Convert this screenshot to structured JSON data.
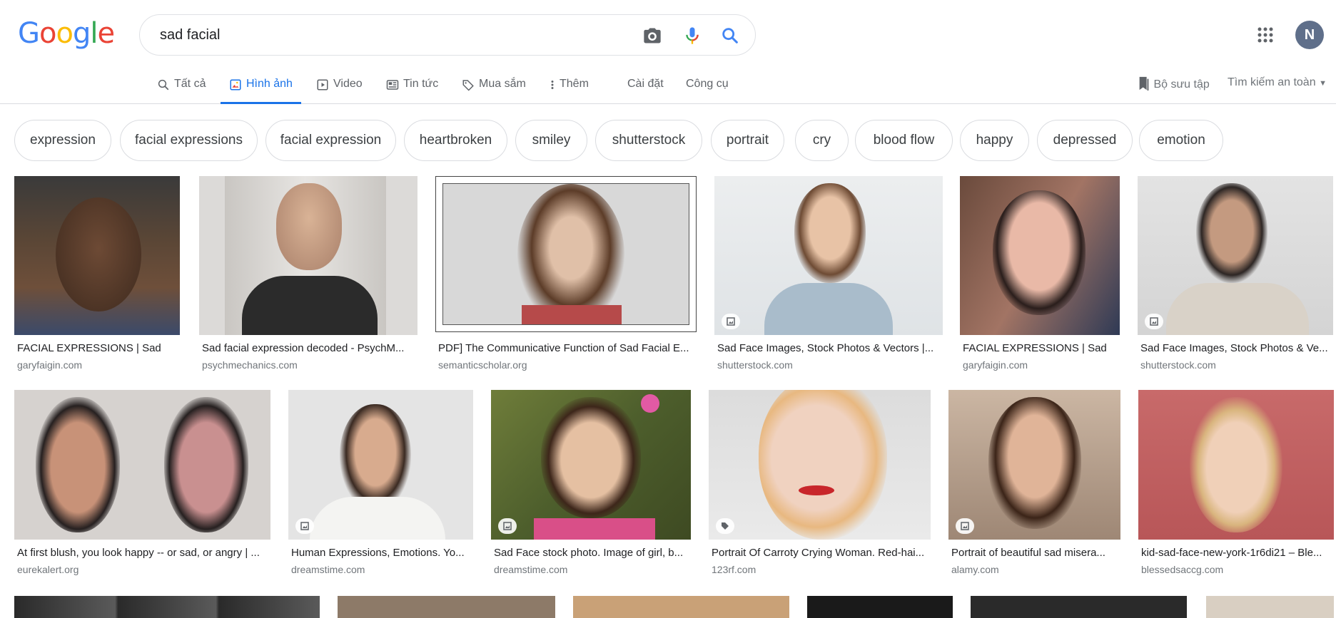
{
  "search": {
    "query": "sad facial"
  },
  "user": {
    "avatar_letter": "N"
  },
  "tabs": [
    {
      "label": "Tất cả",
      "icon": "search-icon"
    },
    {
      "label": "Hình ảnh",
      "icon": "image-icon",
      "active": true
    },
    {
      "label": "Video",
      "icon": "video-icon"
    },
    {
      "label": "Tin tức",
      "icon": "news-icon"
    },
    {
      "label": "Mua sắm",
      "icon": "tag-icon"
    },
    {
      "label": "Thêm",
      "icon": "more-vert-icon"
    },
    {
      "label": "Cài đặt"
    },
    {
      "label": "Công cụ"
    }
  ],
  "right_tools": {
    "collections": "Bộ sưu tập",
    "safe_search": "Tìm kiếm an toàn"
  },
  "chips": [
    "expression",
    "facial expressions",
    "facial expression",
    "heartbroken",
    "smiley",
    "shutterstock",
    "portrait",
    "cry",
    "blood flow",
    "happy",
    "depressed",
    "emotion"
  ],
  "results": [
    {
      "title": "FACIAL EXPRESSIONS | Sad",
      "source": "garyfaigin.com"
    },
    {
      "title": "Sad facial expression decoded - PsychM...",
      "source": "psychmechanics.com"
    },
    {
      "title": "PDF] The Communicative Function of Sad Facial E...",
      "source": "semanticscholar.org"
    },
    {
      "title": "Sad Face Images, Stock Photos & Vectors |...",
      "source": "shutterstock.com"
    },
    {
      "title": "FACIAL EXPRESSIONS | Sad",
      "source": "garyfaigin.com"
    },
    {
      "title": "Sad Face Images, Stock Photos & Ve...",
      "source": "shutterstock.com"
    },
    {
      "title": "At first blush, you look happy -- or sad, or angry | ...",
      "source": "eurekalert.org"
    },
    {
      "title": "Human Expressions, Emotions. Yo...",
      "source": "dreamstime.com"
    },
    {
      "title": "Sad Face stock photo. Image of girl, b...",
      "source": "dreamstime.com"
    },
    {
      "title": "Portrait Of Carroty Crying Woman. Red-hai...",
      "source": "123rf.com"
    },
    {
      "title": "Portrait of beautiful sad misera...",
      "source": "alamy.com"
    },
    {
      "title": "kid-sad-face-new-york-1r6di21 – Ble...",
      "source": "blessedsaccg.com"
    }
  ],
  "colors": {
    "accent": "#1a73e8",
    "text": "#202124",
    "secondary": "#70757a",
    "border": "#dadce0"
  }
}
